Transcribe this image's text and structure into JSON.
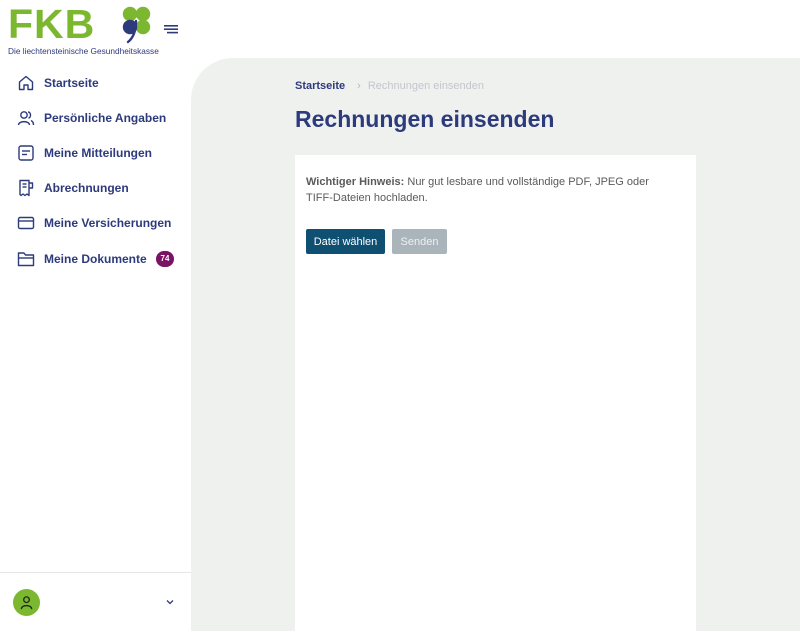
{
  "brand": {
    "logo_text": "FKB",
    "tagline": "Die liechtensteinische Gesundheitskasse",
    "primary_color": "#2d3a7c",
    "green_color": "#7cb82f"
  },
  "nav": {
    "items": [
      {
        "label": "Startseite",
        "icon": "home-icon"
      },
      {
        "label": "Persönliche Angaben",
        "icon": "users-icon"
      },
      {
        "label": "Meine Mitteilungen",
        "icon": "message-icon"
      },
      {
        "label": "Abrechnungen",
        "icon": "receipt-icon"
      },
      {
        "label": "Meine Versicherungen",
        "icon": "card-icon"
      },
      {
        "label": "Meine Dokumente",
        "icon": "folder-icon",
        "badge": "74"
      }
    ],
    "badge_color": "#7a1266"
  },
  "breadcrumb": {
    "home": "Startseite",
    "separator": "›",
    "current": "Rechnungen einsenden"
  },
  "page": {
    "title": "Rechnungen einsenden",
    "notice_label": "Wichtiger Hinweis:",
    "notice_text": " Nur gut lesbare und vollständige PDF, JPEG oder TIFF-Dateien hochladen.",
    "choose_file_label": "Datei wählen",
    "send_label": "Senden"
  }
}
